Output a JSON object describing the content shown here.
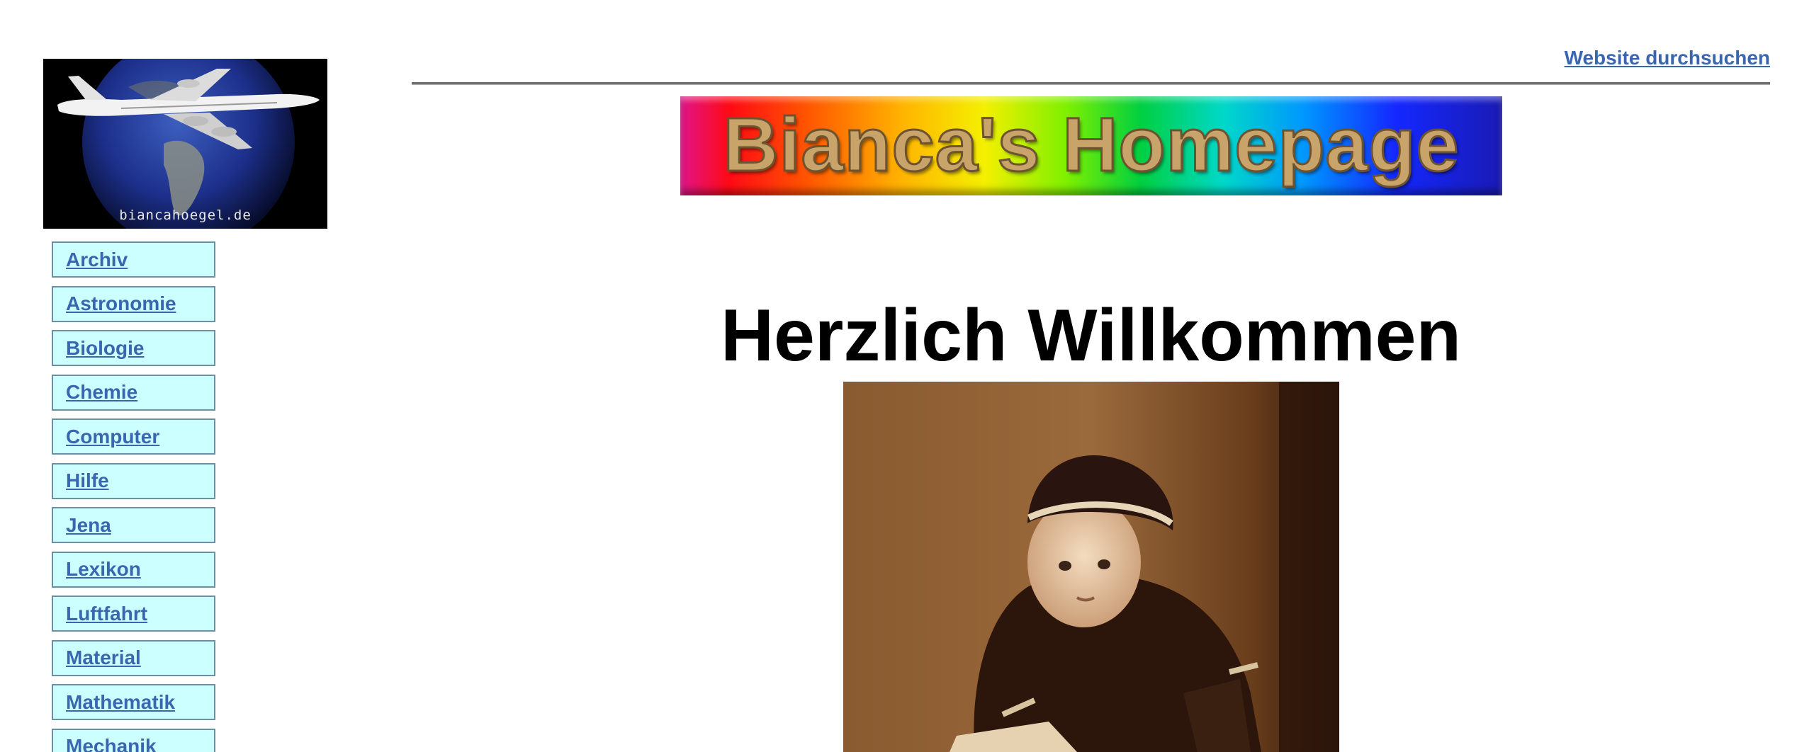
{
  "logo": {
    "caption": "biancahoegel.de",
    "icon": "airplane-over-globe-image"
  },
  "sidebar": {
    "items": [
      {
        "label": "Archiv"
      },
      {
        "label": "Astronomie"
      },
      {
        "label": "Biologie"
      },
      {
        "label": "Chemie"
      },
      {
        "label": "Computer"
      },
      {
        "label": "Hilfe"
      },
      {
        "label": "Jena"
      },
      {
        "label": "Lexikon"
      },
      {
        "label": "Luftfahrt"
      },
      {
        "label": "Material"
      },
      {
        "label": "Mathematik"
      },
      {
        "label": "Mechanik"
      }
    ]
  },
  "header": {
    "search_link": "Website durchsuchen",
    "banner_text": "Bianca's Homepage"
  },
  "main": {
    "heading": "Herzlich Willkommen",
    "photo_icon": "sepia-child-portrait-photo"
  },
  "colors": {
    "link": "#3a66b0",
    "nav_background": "#ccffff",
    "heading": "#000000"
  }
}
